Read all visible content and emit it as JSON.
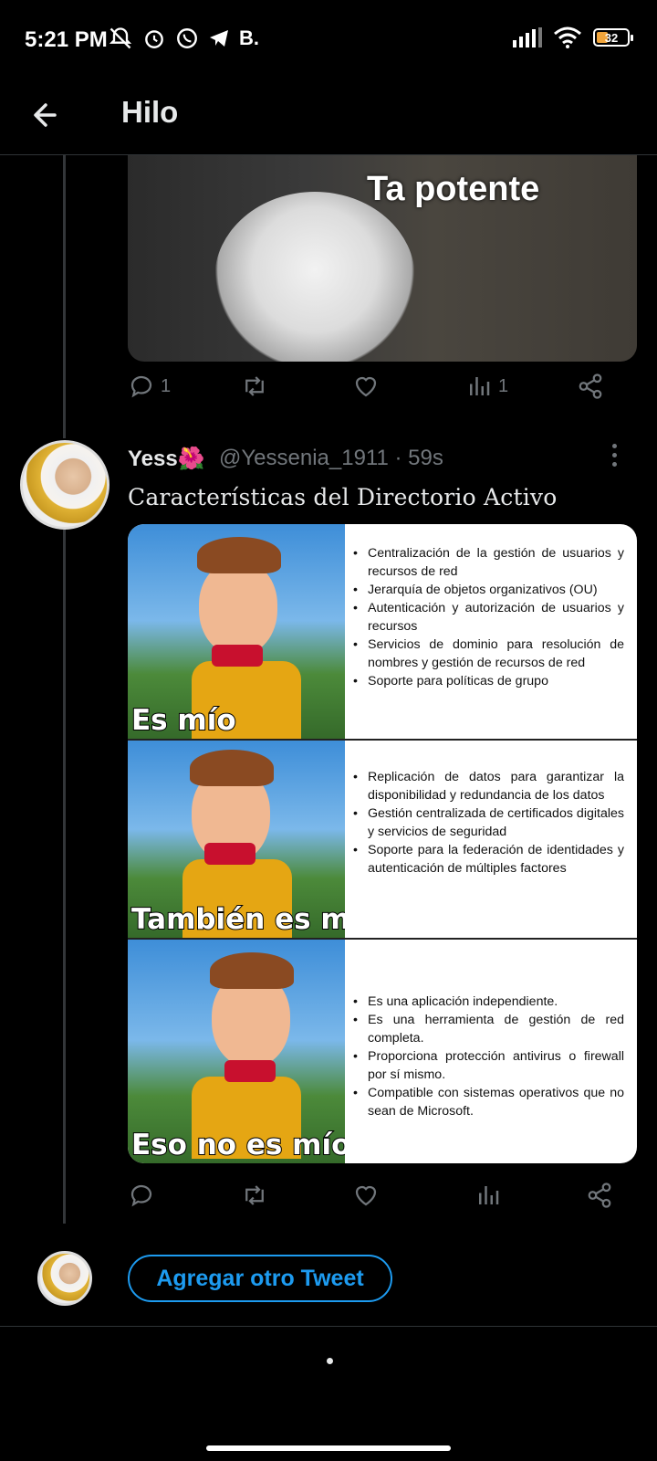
{
  "status": {
    "time": "5:21 PM",
    "extra": "B.",
    "battery": "32",
    "battery_pct": 0.32
  },
  "header": {
    "title": "Hilo"
  },
  "tweet1": {
    "image_caption": "Ta potente",
    "reply_count": "1",
    "views": "1"
  },
  "tweet2": {
    "name": "Yess",
    "emoji": "🌺",
    "handle_time": "@Yessenia_1911 · 59s",
    "text": "Características del Directorio Activo",
    "panels": [
      {
        "label": "Es mío",
        "items": [
          "Centralización de la gestión de usuarios y recursos de red",
          "Jerarquía de objetos organizativos (OU)",
          "Autenticación y autorización de usuarios y recursos",
          "Servicios de dominio para resolución de nombres y gestión de recursos de red",
          "Soporte para políticas de grupo"
        ]
      },
      {
        "label": "También es mío",
        "items": [
          "Replicación de datos para garantizar la disponibilidad y redundancia de los datos",
          "Gestión centralizada de certificados digitales y servicios de seguridad",
          "Soporte para la federación de identidades y autenticación de múltiples factores"
        ]
      },
      {
        "label": "Eso no es mío",
        "items": [
          "Es una aplicación independiente.",
          "Es una herramienta de gestión de red completa.",
          "Proporciona protección antivirus o firewall por sí mismo.",
          "Compatible con sistemas operativos que no sean de Microsoft."
        ]
      }
    ]
  },
  "compose": {
    "add_label": "Agregar otro Tweet"
  },
  "icons": [
    "back-arrow-icon",
    "reply-icon",
    "retweet-icon",
    "like-icon",
    "views-icon",
    "share-icon",
    "more-icon"
  ],
  "colors": {
    "accent": "#1d9bf0",
    "muted": "#71767b",
    "background": "#000000"
  }
}
